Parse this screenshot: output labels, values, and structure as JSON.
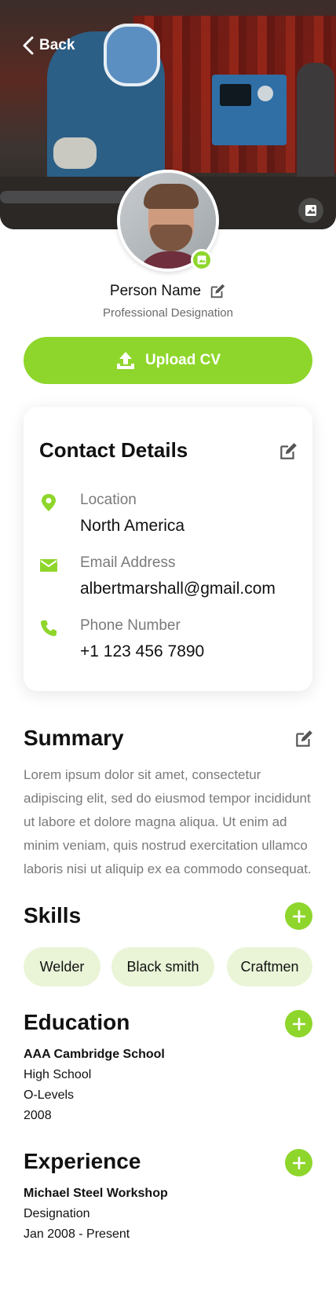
{
  "header": {
    "back_label": "Back"
  },
  "profile": {
    "name": "Person Name",
    "designation": "Professional Designation",
    "upload_label": "Upload CV"
  },
  "contact": {
    "title": "Contact Details",
    "items": [
      {
        "label": "Location",
        "value": "North America"
      },
      {
        "label": "Email Address",
        "value": "albertmarshall@gmail.com"
      },
      {
        "label": "Phone Number",
        "value": "+1 123 456 7890"
      }
    ]
  },
  "summary": {
    "title": "Summary",
    "text": "Lorem ipsum dolor sit amet, consectetur adipiscing elit, sed do eiusmod tempor incididunt ut labore et dolore magna aliqua. Ut enim ad minim veniam, quis nostrud exercitation ullamco laboris nisi ut aliquip ex ea commodo consequat."
  },
  "skills": {
    "title": "Skills",
    "items": [
      "Welder",
      "Black smith",
      "Craftmen"
    ]
  },
  "education": {
    "title": "Education",
    "school": "AAA Cambridge School",
    "level": "High School",
    "qualification": "O-Levels",
    "year": "2008"
  },
  "experience": {
    "title": "Experience",
    "company": "Michael Steel Workshop",
    "designation": "Designation",
    "period": "Jan 2008 - Present"
  },
  "colors": {
    "accent": "#8ed62b",
    "chip_bg": "#eaf5d8",
    "muted_text": "#7a7a7a"
  }
}
